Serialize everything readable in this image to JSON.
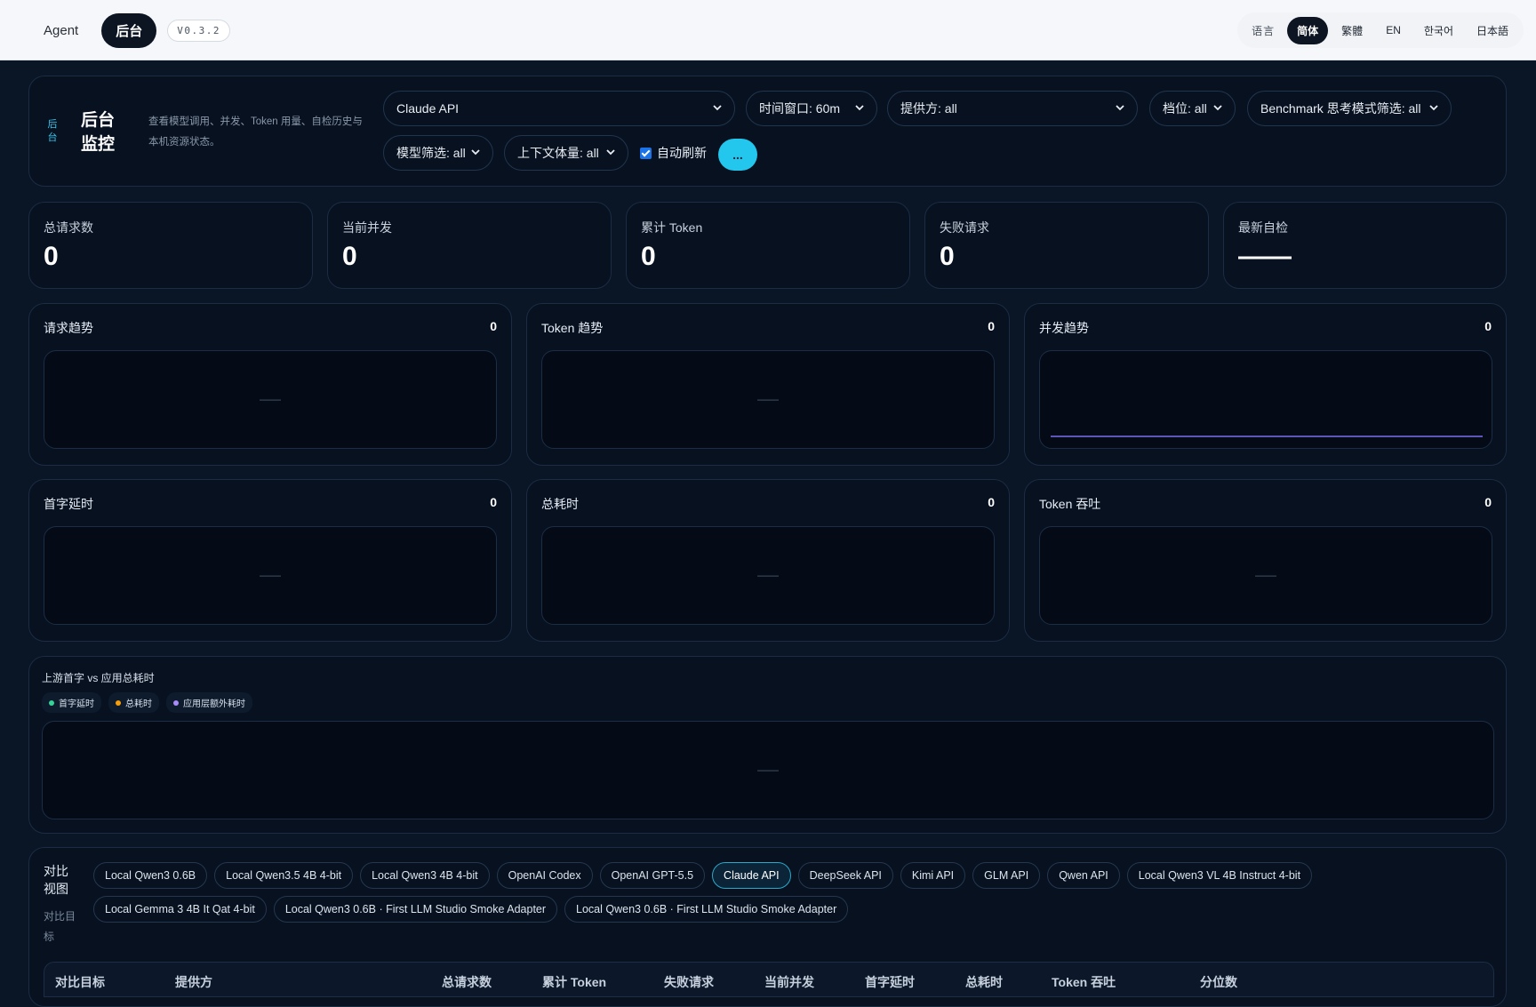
{
  "topbar": {
    "agent_label": "Agent",
    "admin_label": "后台",
    "version": "V0.3.2",
    "lang_label": "语言",
    "langs": [
      "简体",
      "繁體",
      "EN",
      "한국어",
      "日本語"
    ]
  },
  "header": {
    "side_tag": "后台",
    "title": "后台监控",
    "desc": "查看模型调用、并发、Token 用量、自检历史与本机资源状态。",
    "model_select": "Claude API",
    "window_select": "时间窗口: 60m",
    "provider_select": "提供方: all",
    "tier_select": "档位: all",
    "benchmark_select": "Benchmark 思考模式筛选: all",
    "model_filter": "模型筛选: all",
    "context_select": "上下文体量: all",
    "autorefresh_label": "自动刷新",
    "more_label": "..."
  },
  "stats": [
    {
      "label": "总请求数",
      "value": "0"
    },
    {
      "label": "当前并发",
      "value": "0"
    },
    {
      "label": "累计 Token",
      "value": "0"
    },
    {
      "label": "失败请求",
      "value": "0"
    },
    {
      "label": "最新自检",
      "value": "——"
    }
  ],
  "charts": [
    {
      "title": "请求趋势",
      "count": "0",
      "empty": "——"
    },
    {
      "title": "Token 趋势",
      "count": "0",
      "empty": "——"
    },
    {
      "title": "并发趋势",
      "count": "0",
      "empty": ""
    },
    {
      "title": "首字延时",
      "count": "0",
      "empty": "——"
    },
    {
      "title": "总耗时",
      "count": "0",
      "empty": "——"
    },
    {
      "title": "Token 吞吐",
      "count": "0",
      "empty": "——"
    }
  ],
  "latency": {
    "title": "上游首字 vs 应用总耗时",
    "legend": [
      "首字延时",
      "总耗时",
      "应用层额外耗时"
    ],
    "legend_colors": [
      "#34d399",
      "#f59e0b",
      "#a78bfa"
    ],
    "empty": "——"
  },
  "compare": {
    "title": "对比视图",
    "sub": "对比目标",
    "chips_row1": [
      "Local Qwen3 0.6B",
      "Local Qwen3.5 4B 4-bit",
      "Local Qwen3 4B 4-bit",
      "OpenAI Codex",
      "OpenAI GPT-5.5",
      "Claude API",
      "DeepSeek API",
      "Kimi API",
      "GLM API",
      "Qwen API",
      "Local Qwen3 VL 4B Instruct 4-bit"
    ],
    "chips_row2": [
      "Local Gemma 3 4B It Qat 4-bit",
      "Local Qwen3 0.6B · First LLM Studio Smoke Adapter",
      "Local Qwen3 0.6B · First LLM Studio Smoke Adapter"
    ],
    "active_chip": "Claude API",
    "columns": [
      "对比目标",
      "提供方",
      "总请求数",
      "累计 Token",
      "失败请求",
      "当前并发",
      "首字延时",
      "总耗时",
      "Token 吞吐",
      "分位数"
    ]
  }
}
